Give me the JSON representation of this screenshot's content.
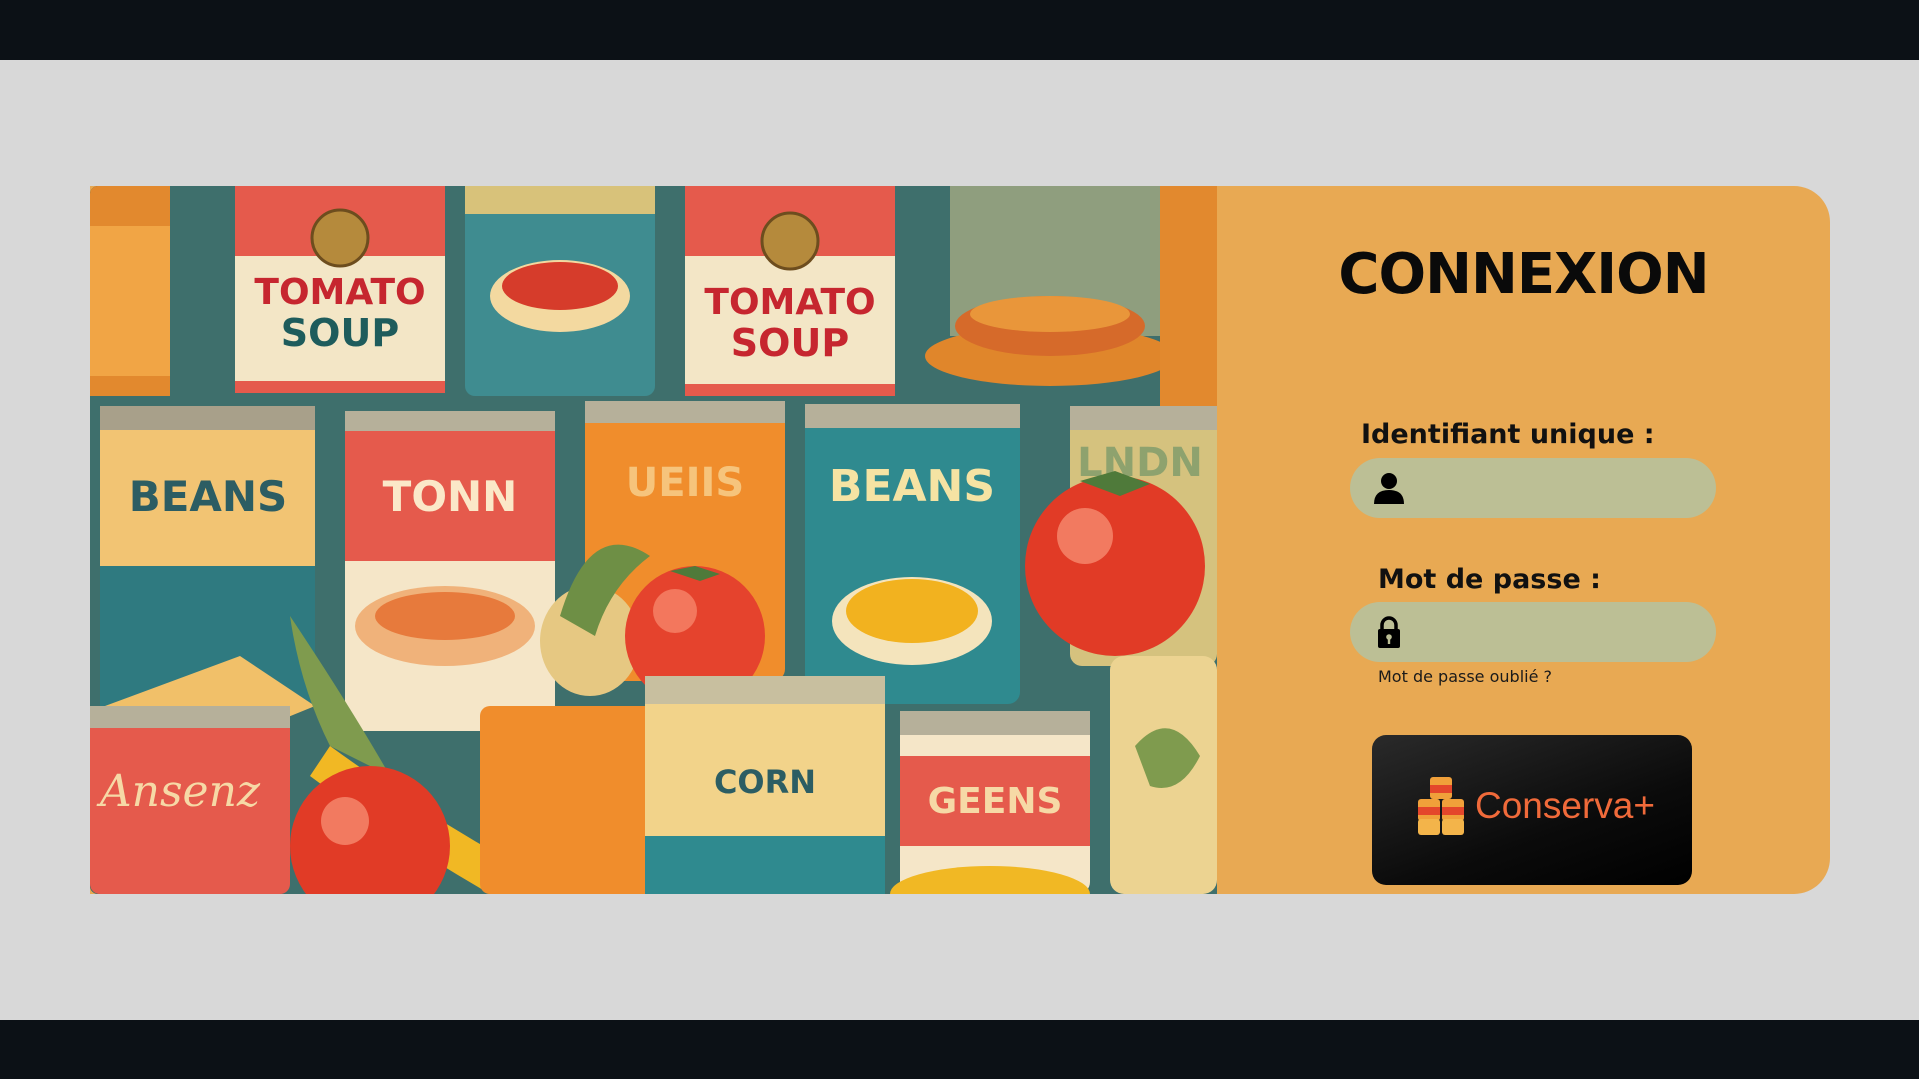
{
  "login": {
    "title": "CONNEXION",
    "identifier_label": "Identifiant unique :",
    "identifier_value": "",
    "password_label": "Mot de passe :",
    "password_value": "",
    "forgot_password": "Mot de passe oublié ?"
  },
  "brand": {
    "name": "Conserva+"
  },
  "illustration": {
    "cans": [
      {
        "top": "TOMATO",
        "bottom": "SOUP"
      },
      {
        "top": "TOMATO",
        "bottom": "SOUP"
      },
      {
        "label": "BEANS"
      },
      {
        "label": "TONN"
      },
      {
        "label": "UEIIS"
      },
      {
        "label": "BEANS"
      },
      {
        "label": "CORN"
      },
      {
        "label": "GEENS"
      },
      {
        "label": "LNDN"
      }
    ]
  },
  "colors": {
    "panel": "#e8a953",
    "input": "#bcbf95",
    "brand_text": "#f06a3a",
    "page_background": "#d8d8d8",
    "frame": "#0c1116"
  },
  "icons": {
    "identifier": "user-icon",
    "password": "lock-icon",
    "brand": "stacked-cans-icon"
  }
}
